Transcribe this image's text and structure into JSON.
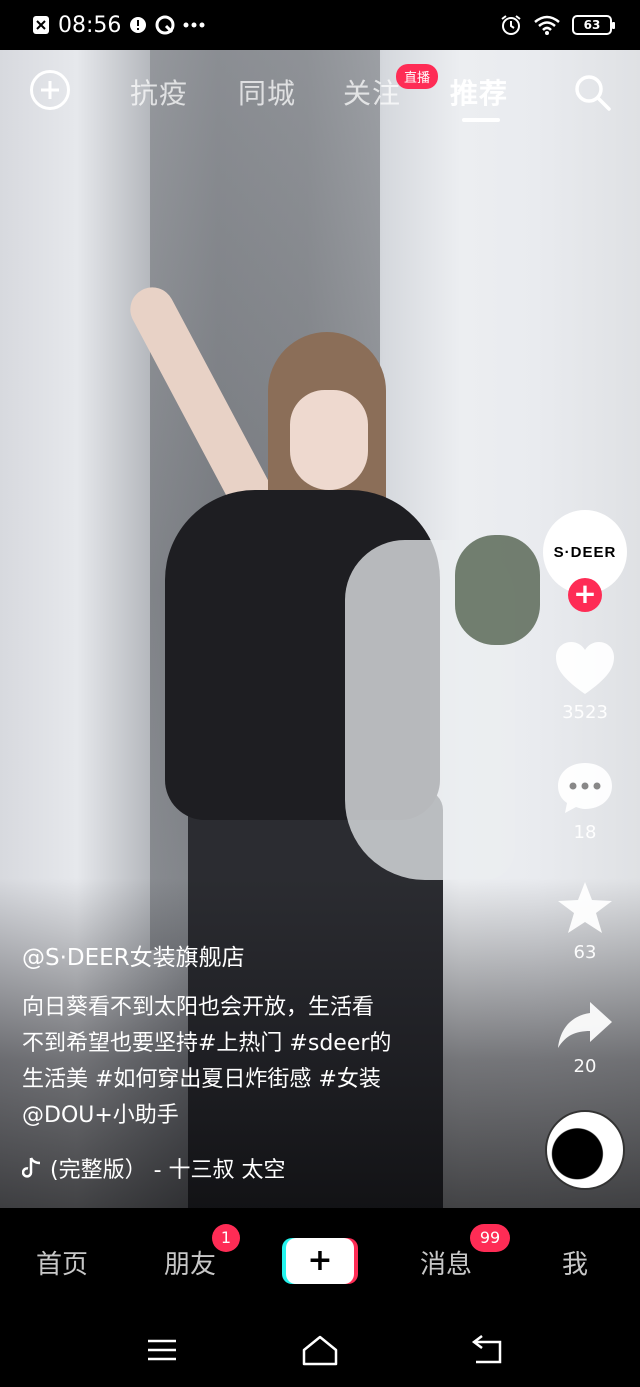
{
  "status_bar": {
    "time": "08:56",
    "battery": "63"
  },
  "top_nav": {
    "tabs": [
      "抗疫",
      "同城",
      "关注",
      "推荐"
    ],
    "active_tab": "推荐",
    "live_badge": "直播"
  },
  "rail": {
    "avatar_text": "S·DEER",
    "likes": "3523",
    "comments": "18",
    "favorites": "63",
    "shares": "20"
  },
  "caption": {
    "author": "@S·DEER女装旗舰店",
    "description_lines": [
      "向日葵看不到太阳也会开放，生活看",
      "不到希望也要坚持#上热门 #sdeer的",
      "生活美 #如何穿出夏日炸街感 #女装",
      "@DOU+小助手"
    ],
    "music": "(完整版） - 十三叔    太空"
  },
  "bottom_nav": {
    "home": "首页",
    "friends": "朋友",
    "friends_badge": "1",
    "create": "+",
    "messages": "消息",
    "messages_badge": "99",
    "me": "我"
  },
  "colors": {
    "accent": "#fe2c55",
    "cyan": "#25f4ee"
  }
}
